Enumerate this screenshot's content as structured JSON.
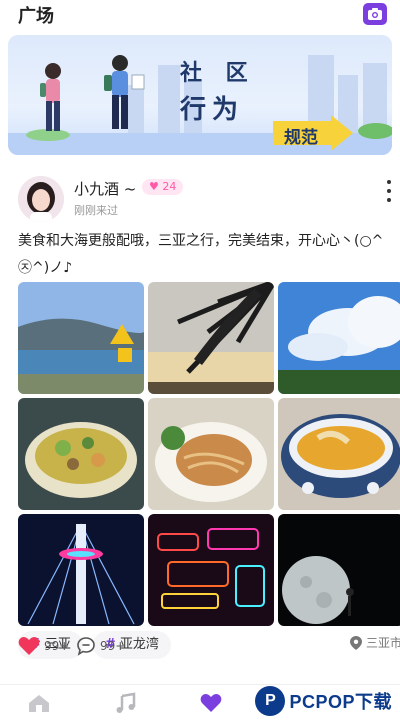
{
  "header": {
    "title": "广场",
    "camera_icon": "camera-icon"
  },
  "banner": {
    "slogan_line1": "社 区",
    "slogan_line2": "行为",
    "tag": "规范"
  },
  "post": {
    "user_name": "小九酒 ~",
    "level_badge": "24",
    "visited": "刚刚来过",
    "text": "美食和大海更般配哦，三亚之行，完美结束，开心心丶(○^㉨^)ノ♪",
    "images": [
      "sea-coast-photo",
      "palm-sunset-photo",
      "clouds-sky-photo",
      "food-bowl-photo",
      "pad-thai-photo",
      "curry-shrimp-photo",
      "tower-night-photo",
      "neon-signs-photo",
      "moon-night-photo"
    ],
    "hashtags": [
      "三亚",
      "亚龙湾"
    ],
    "location": "三亚市",
    "likes": "99+",
    "comments": "99+"
  },
  "tabbar": {
    "items": [
      "home-icon",
      "music-icon",
      "heart-icon"
    ]
  },
  "watermark": {
    "logo_letter": "P",
    "text": "PCPOP下载"
  },
  "colors": {
    "accent": "#7b3fe0",
    "like": "#f0365b",
    "badge": "#ff5aa7"
  }
}
